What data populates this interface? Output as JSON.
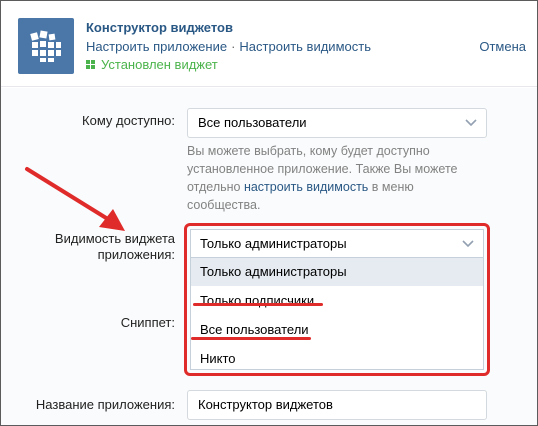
{
  "header": {
    "title": "Конструктор виджетов",
    "link_settings": "Настроить приложение",
    "link_separator": "·",
    "link_visibility": "Настроить видимость",
    "status": "Установлен виджет",
    "cancel": "Отмена"
  },
  "form": {
    "access_label": "Кому доступно:",
    "access_value": "Все пользователи",
    "hint_line1": "Вы можете выбрать, кому будет доступно",
    "hint_line2": "установленное приложение. Также Вы можете",
    "hint_line3_pre": "отдельно ",
    "hint_link": "настроить видимость",
    "hint_line3_post": " в меню",
    "hint_line4": "сообщества.",
    "visibility_label_line1": "Видимость виджета",
    "visibility_label_line2": "приложения:",
    "visibility_value": "Только администраторы",
    "visibility_options": [
      "Только администраторы",
      "Только подписчики",
      "Все пользователи",
      "Никто"
    ],
    "snippet_label": "Сниппет:",
    "name_label": "Название приложения:",
    "name_value": "Конструктор виджетов"
  },
  "colors": {
    "accent": "#4a76a8",
    "link": "#2a5885",
    "status_green": "#4bb34b",
    "annotation_red": "#e02b2b"
  },
  "icons": {
    "app": "widget-grid-icon",
    "status": "grid-dots-icon",
    "chevron": "chevron-down-icon"
  }
}
